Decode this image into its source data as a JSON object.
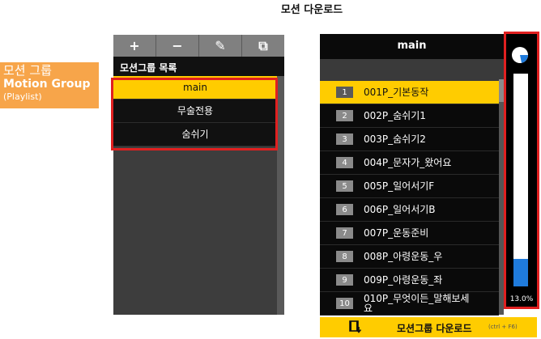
{
  "page": {
    "title": "모션 다운로드"
  },
  "callout": {
    "korean": "모션 그룹",
    "english": "Motion Group",
    "sub": "(Playlist)"
  },
  "left_panel": {
    "toolbar": [
      {
        "label": "+",
        "name": "add-group-button"
      },
      {
        "label": "−",
        "name": "remove-group-button"
      },
      {
        "label": "✎",
        "name": "edit-group-button"
      },
      {
        "label": "⧉",
        "name": "copy-group-button"
      }
    ],
    "header": "모션그룹 목록",
    "groups": [
      {
        "label": "main",
        "active": true
      },
      {
        "label": "무술전용",
        "active": false
      },
      {
        "label": "숨쉬기",
        "active": false
      }
    ]
  },
  "right_panel": {
    "header": "main",
    "motions": [
      {
        "num": "1",
        "label": "001P_기본동작",
        "active": true
      },
      {
        "num": "2",
        "label": "002P_숨쉬기1",
        "active": false
      },
      {
        "num": "3",
        "label": "003P_숨쉬기2",
        "active": false
      },
      {
        "num": "4",
        "label": "004P_문자가_왔어요",
        "active": false
      },
      {
        "num": "5",
        "label": "005P_일어서기F",
        "active": false
      },
      {
        "num": "6",
        "label": "006P_일어서기B",
        "active": false
      },
      {
        "num": "7",
        "label": "007P_운동준비",
        "active": false
      },
      {
        "num": "8",
        "label": "008P_아령운동_우",
        "active": false
      },
      {
        "num": "9",
        "label": "009P_아령운동_좌",
        "active": false
      },
      {
        "num": "10",
        "label": "010P_무엇이든_말해보세요",
        "active": false
      }
    ]
  },
  "progress": {
    "percent_label": "13.0%",
    "value": 0.13,
    "accent": "#1f7bdc"
  },
  "download": {
    "label": "모션그룹 다운로드",
    "hint": "(ctrl + F6)"
  },
  "colors": {
    "highlight": "#ffcc00",
    "annotation": "#e02020",
    "callout": "#f7a54a"
  }
}
